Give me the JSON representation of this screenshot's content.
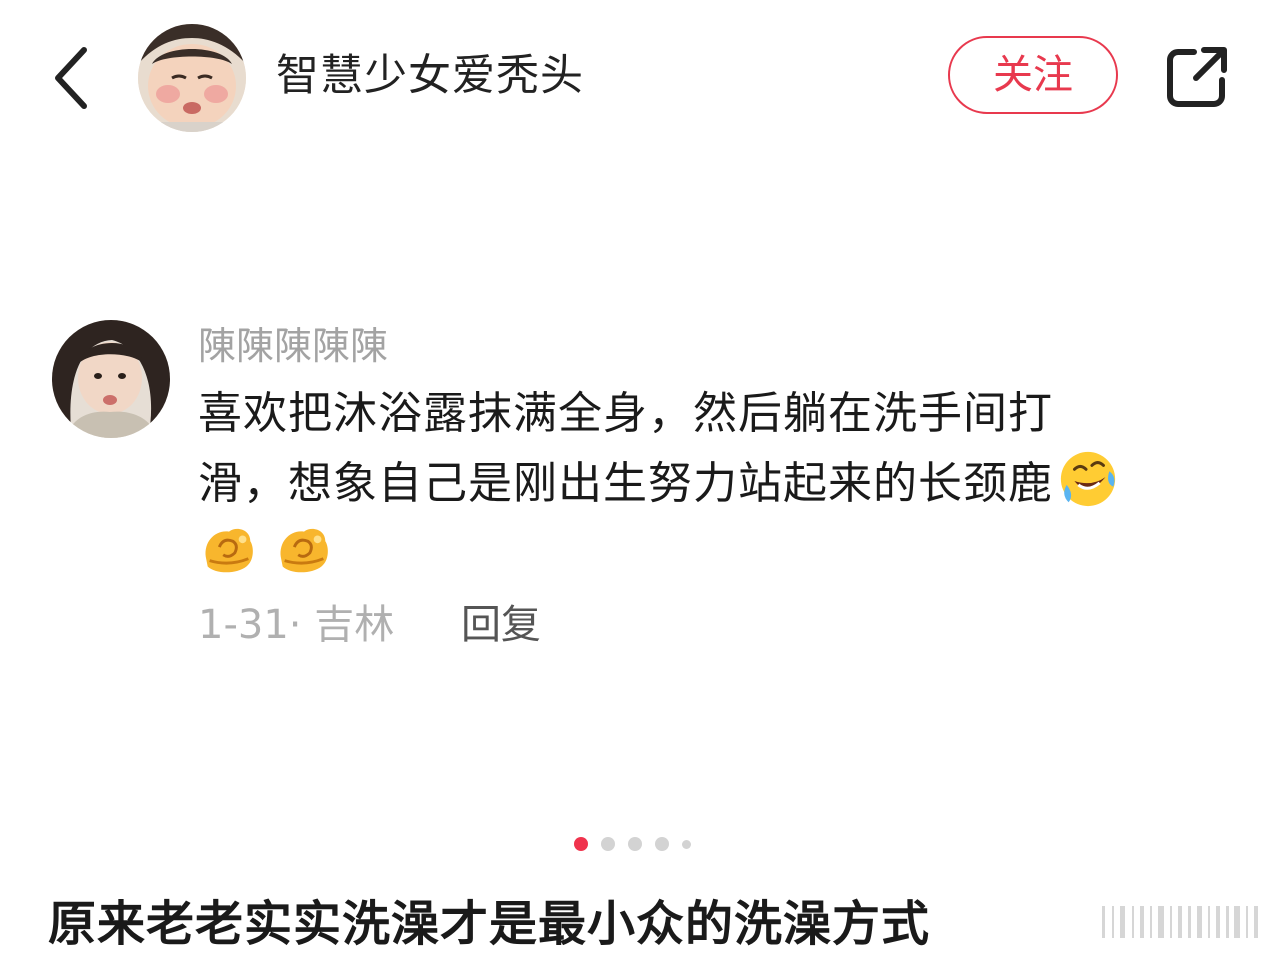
{
  "header": {
    "author_name": "智慧少女爱秃头",
    "follow_label": "关注",
    "icons": {
      "back": "chevron-left-icon",
      "share": "share-external-icon"
    }
  },
  "comment": {
    "author_name": "陳陳陳陳陳",
    "text_line_1": "喜欢把沐浴露抹满全身，然后躺在洗手间打",
    "text_line_2": "滑，想象自己是刚出生努力站起来的长颈鹿",
    "emojis": [
      "rofl-emoji",
      "strong-emoji",
      "strong-emoji"
    ],
    "date_location": "1-31· 吉林",
    "reply_label": "回复"
  },
  "pagination": {
    "total_dots": 5,
    "active_index": 0
  },
  "post": {
    "title": "原来老老实实洗澡才是最小众的洗澡方式"
  },
  "colors": {
    "accent": "#e8394e",
    "active_dot": "#f0334d",
    "muted_text": "#a3a3a3",
    "body_text": "#1a1a1a"
  }
}
